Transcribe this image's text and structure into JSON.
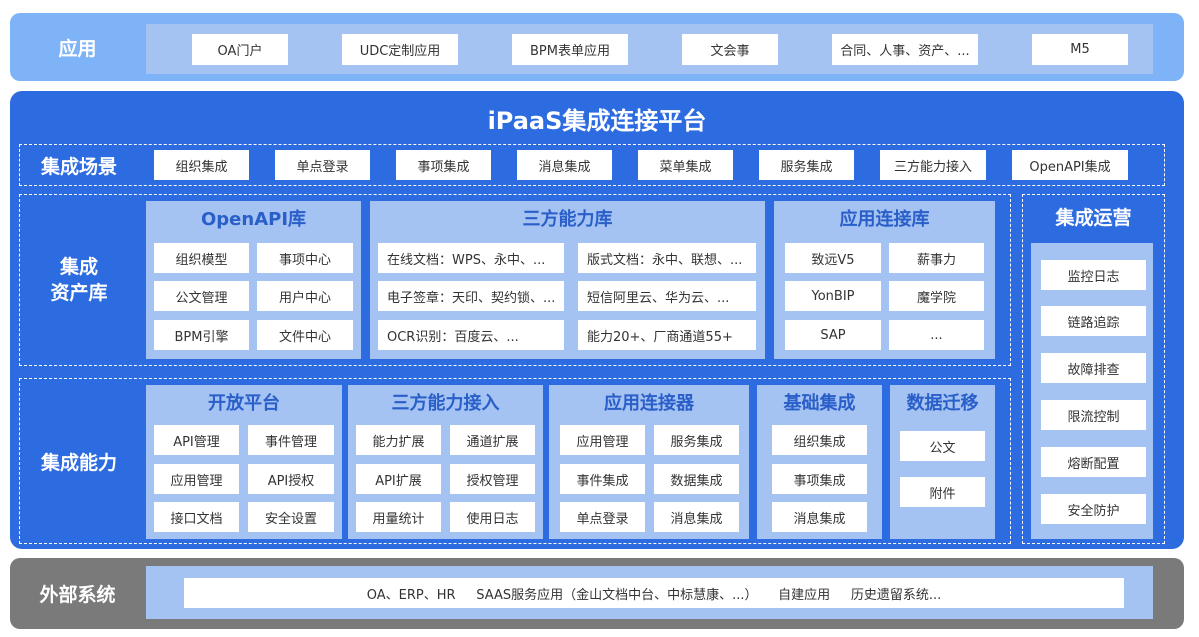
{
  "app_layer": {
    "label": "应用",
    "items": [
      "OA门户",
      "UDC定制应用",
      "BPM表单应用",
      "文会事",
      "合同、人事、资产、...",
      "M5"
    ]
  },
  "platform": {
    "title": "iPaaS集成连接平台",
    "scenarios": {
      "label": "集成场景",
      "items": [
        "组织集成",
        "单点登录",
        "事项集成",
        "消息集成",
        "菜单集成",
        "服务集成",
        "三方能力接入",
        "OpenAPI集成"
      ]
    },
    "assets": {
      "label_line1": "集成",
      "label_line2": "资产库",
      "openapi": {
        "title": "OpenAPI库",
        "items": [
          "组织模型",
          "事项中心",
          "公文管理",
          "用户中心",
          "BPM引擎",
          "文件中心"
        ]
      },
      "thirdparty": {
        "title": "三方能力库",
        "items": [
          "在线文档：WPS、永中、...",
          "版式文档：永中、联想、...",
          "电子签章：天印、契约锁、...",
          "短信阿里云、华为云、...",
          "OCR识别：百度云、...",
          "能力20+、厂商通道55+"
        ]
      },
      "apps": {
        "title": "应用连接库",
        "items": [
          "致远V5",
          "薪事力",
          "YonBIP",
          "魔学院",
          "SAP",
          "..."
        ]
      }
    },
    "capabilities": {
      "label": "集成能力",
      "open_platform": {
        "title": "开放平台",
        "items": [
          "API管理",
          "事件管理",
          "应用管理",
          "API授权",
          "接口文档",
          "安全设置"
        ]
      },
      "third_access": {
        "title": "三方能力接入",
        "items": [
          "能力扩展",
          "通道扩展",
          "API扩展",
          "授权管理",
          "用量统计",
          "使用日志"
        ]
      },
      "app_connector": {
        "title": "应用连接器",
        "items": [
          "应用管理",
          "服务集成",
          "事件集成",
          "数据集成",
          "单点登录",
          "消息集成"
        ]
      },
      "basic": {
        "title": "基础集成",
        "items": [
          "组织集成",
          "事项集成",
          "消息集成"
        ]
      },
      "migration": {
        "title": "数据迁移",
        "items": [
          "公文",
          "附件"
        ]
      }
    },
    "operations": {
      "title": "集成运营",
      "items": [
        "监控日志",
        "链路追踪",
        "故障排查",
        "限流控制",
        "熔断配置",
        "安全防护"
      ]
    }
  },
  "external": {
    "label": "外部系统",
    "text": "OA、ERP、HR     SAAS服务应用（金山文档中台、中标慧康、...）     自建应用     历史遗留系统..."
  },
  "colors": {
    "top_band": "#7fb3f7",
    "main_blue": "#2d6be0",
    "light_panel": "#a4c2f2",
    "bottom_band": "#7a7a7a",
    "title_blue": "#2a5fc9"
  }
}
